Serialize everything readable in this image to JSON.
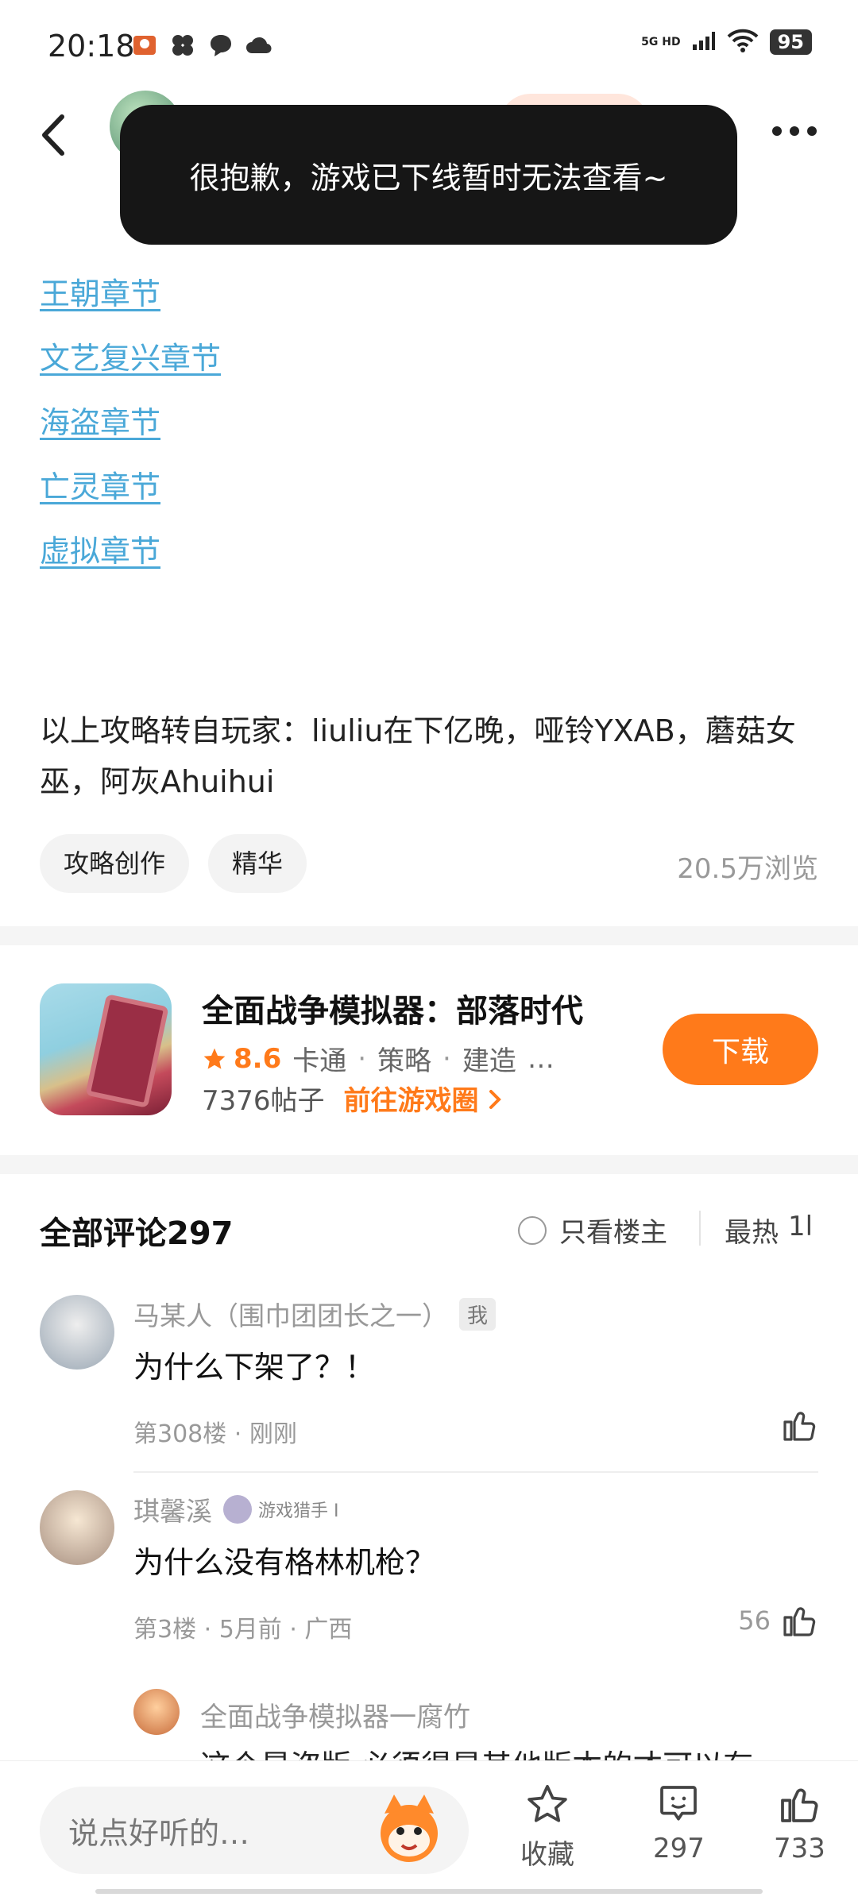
{
  "status": {
    "time": "20:18",
    "network": "5G HD",
    "battery": "95"
  },
  "toast": {
    "message": "很抱歉，游戏已下线暂时无法查看~"
  },
  "chapters": [
    {
      "label": "王朝章节"
    },
    {
      "label": "文艺复兴章节"
    },
    {
      "label": "海盗章节"
    },
    {
      "label": "亡灵章节"
    },
    {
      "label": "虚拟章节"
    }
  ],
  "credit": "以上攻略转自玩家：liuliu在下亿晚，哑铃YXAB，蘑菇女巫，阿灰Ahuihui",
  "tags": [
    "攻略创作",
    "精华"
  ],
  "views": "20.5万浏览",
  "game": {
    "title": "全面战争模拟器：部落时代",
    "rating": "8.6",
    "genres": [
      "卡通",
      "策略",
      "建造"
    ],
    "more": "…",
    "posts": "7376帖子",
    "goto_label": "前往游戏圈",
    "download_label": "下载",
    "accent_color": "#ff7a1a"
  },
  "comments_header": {
    "title": "全部评论297",
    "owner_only": "只看楼主",
    "sort": "最热",
    "sort_icon": "1l"
  },
  "comments": [
    {
      "name": "马某人（围巾团团长之一）",
      "badge": "我",
      "text": "为什么下架了？！",
      "meta": "第308楼 · 刚刚",
      "likes": ""
    },
    {
      "name": "琪馨溪",
      "badge": "游戏猎手 I",
      "text": "为什么没有格林机枪？",
      "meta": "第3楼 · 5月前 · 广西",
      "likes": "56"
    }
  ],
  "reply": {
    "name": "全面战争模拟器一腐竹",
    "text": "这个是盗版 必须得是其他版本的才可以有"
  },
  "bottom_bar": {
    "placeholder": "说点好听的…",
    "favorite_label": "收藏",
    "comments_count": "297",
    "likes_count": "733"
  }
}
